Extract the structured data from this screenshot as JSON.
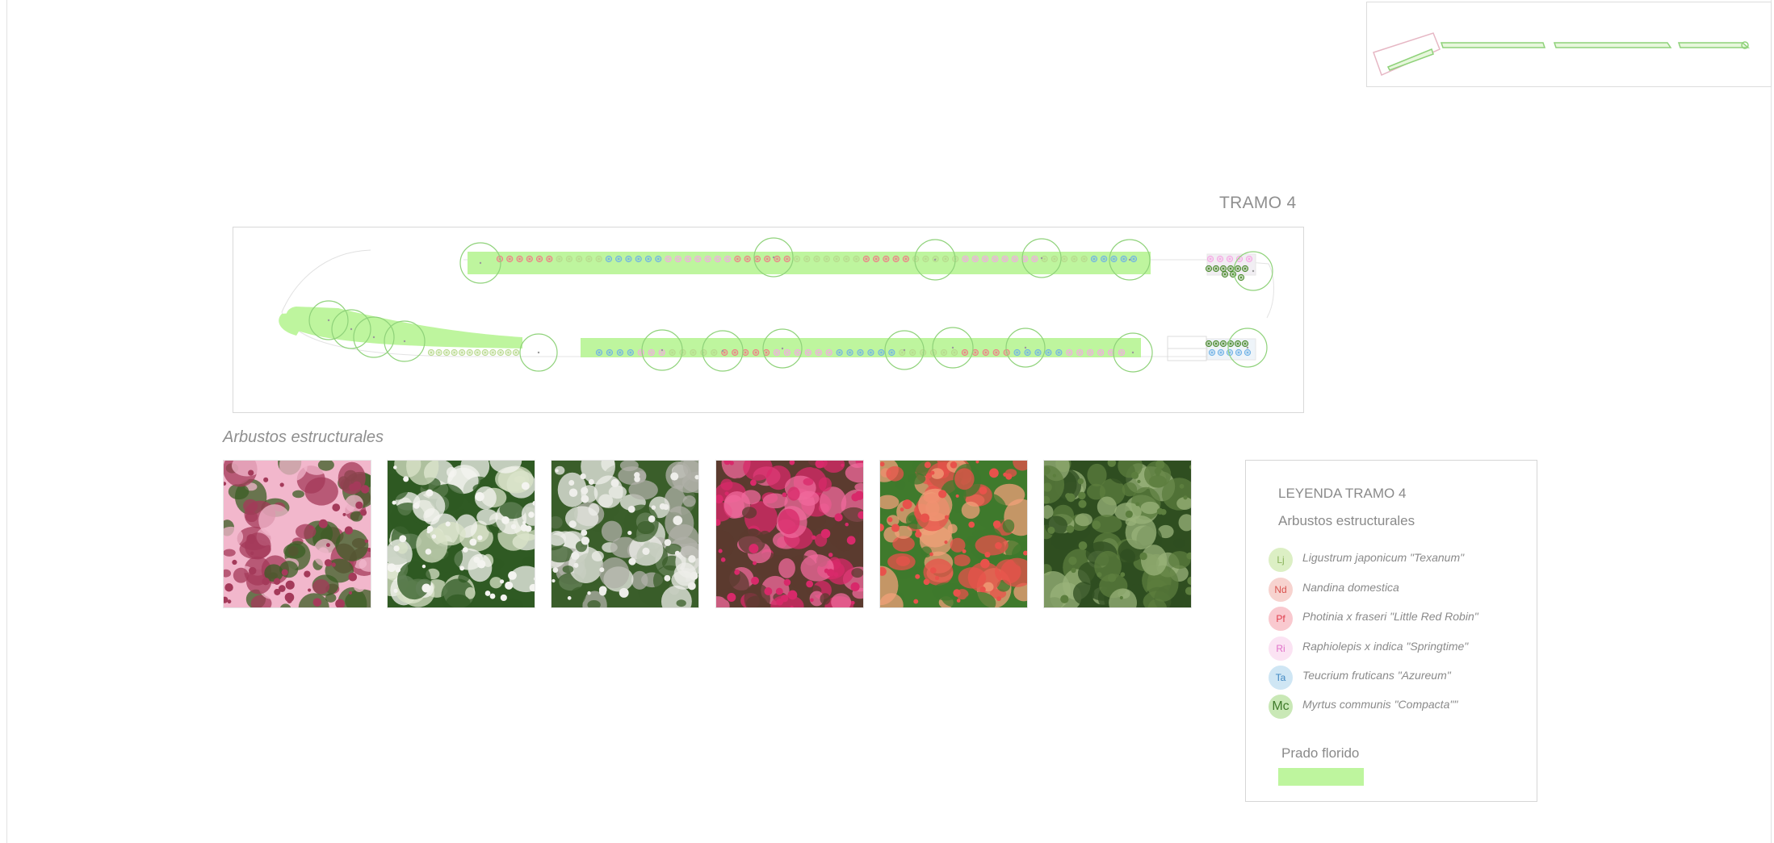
{
  "section": {
    "title": "TRAMO 4"
  },
  "gallery": {
    "title": "Arbustos estructurales",
    "photos": [
      {
        "name": "abelia-photo",
        "colors": [
          "#a43a5a",
          "#f2b7cc",
          "#3b5e24"
        ]
      },
      {
        "name": "white-flowers-photo",
        "colors": [
          "#f4f4f0",
          "#2f5a23",
          "#d9e3c8"
        ]
      },
      {
        "name": "white-flowers-2-photo",
        "colors": [
          "#eeeeea",
          "#3a5e2a",
          "#b0b0a8"
        ]
      },
      {
        "name": "loropetalum-photo",
        "colors": [
          "#d8296a",
          "#5b3b2f",
          "#f06a9c"
        ]
      },
      {
        "name": "photinia-photo",
        "colors": [
          "#e8524b",
          "#3f7a2c",
          "#f2a07a"
        ]
      },
      {
        "name": "myrtus-photo",
        "colors": [
          "#5c7e3e",
          "#2f4e20",
          "#9ab37a"
        ]
      }
    ]
  },
  "legend": {
    "title": "LEYENDA TRAMO 4",
    "subtitle": "Arbustos estructurales",
    "items": [
      {
        "code": "Lj",
        "label": "Ligustrum japonicum \"Texanum\"",
        "bg": "#dcefc4",
        "fg": "#8ab35a"
      },
      {
        "code": "Nd",
        "label": "Nandina domestica",
        "bg": "#f7d3cf",
        "fg": "#d9534f"
      },
      {
        "code": "Pf",
        "label": "Photinia x fraseri \"Little Red Robin\"",
        "bg": "#f9c9cf",
        "fg": "#e03c4c"
      },
      {
        "code": "Ri",
        "label": "Raphiolepis x indica \"Springtime\"",
        "bg": "#fbe3f3",
        "fg": "#e070c8"
      },
      {
        "code": "Ta",
        "label": "Teucrium fruticans \"Azureum\"",
        "bg": "#cfe6f4",
        "fg": "#3f87c2"
      },
      {
        "code": "Mc",
        "label": "Myrtus communis \"Compacta\"\"",
        "bg": "#c9e8b6",
        "fg": "#3f7a2a"
      }
    ],
    "prado_label": "Prado florido",
    "prado_color": "#bef59e"
  },
  "colors": {
    "meadow": "#bef59e",
    "tree_stroke": "#8fd27a",
    "outline": "#c8c8c8",
    "Lj": "#b8d98d",
    "Nd": "#f0a49e",
    "Pf": "#f07c86",
    "Ri": "#f5a8e4",
    "Ta": "#6fb2e6",
    "Mc": "#4b8a2e"
  },
  "plan": {
    "rows": [
      {
        "name": "upper-row",
        "sequence": [
          "Pf",
          "Pf",
          "Pf",
          "Pf",
          "Pf",
          "Pf",
          "Lj",
          "Lj",
          "Lj",
          "Lj",
          "Lj",
          "Ta",
          "Ta",
          "Ta",
          "Ta",
          "Ta",
          "Ta",
          "Ri",
          "Ri",
          "Ri",
          "Ri",
          "Ri",
          "Ri",
          "Ri",
          "Pf",
          "Pf",
          "Pf",
          "Pf",
          "Pf",
          "Pf",
          "Lj",
          "Lj",
          "Lj",
          "Lj",
          "Lj",
          "Lj",
          "Lj",
          "Pf",
          "Pf",
          "Pf",
          "Pf",
          "Pf",
          "Lj",
          "Lj",
          "Lj",
          "Lj",
          "Lj",
          "Ri",
          "Ri",
          "Ri",
          "Ri",
          "Ri",
          "Ri",
          "Ri",
          "Ri",
          "Lj",
          "Lj",
          "Lj",
          "Lj",
          "Lj",
          "Ta",
          "Ta",
          "Ta",
          "Ta",
          "Ta"
        ]
      },
      {
        "name": "lower-row",
        "sequence": [
          "Ta",
          "Ta",
          "Ta",
          "Ta",
          "Ri",
          "Ri",
          "Ri",
          "Lj",
          "Lj",
          "Lj",
          "Lj",
          "Lj",
          "Pf",
          "Pf",
          "Pf",
          "Pf",
          "Pf",
          "Ri",
          "Ri",
          "Ri",
          "Ri",
          "Ri",
          "Ri",
          "Ta",
          "Ta",
          "Ta",
          "Ta",
          "Ta",
          "Ta",
          "Lj",
          "Lj",
          "Lj",
          "Lj",
          "Lj",
          "Lj",
          "Pf",
          "Pf",
          "Pf",
          "Pf",
          "Pf",
          "Ta",
          "Ta",
          "Ta",
          "Ta",
          "Ta",
          "Ri",
          "Ri",
          "Ri",
          "Ri",
          "Ri",
          "Ri"
        ]
      },
      {
        "name": "lower-left-row",
        "sequence": [
          "Lj",
          "Lj",
          "Lj",
          "Lj",
          "Lj",
          "Lj",
          "Lj",
          "Lj",
          "Lj",
          "Lj",
          "Lj",
          "Lj"
        ]
      }
    ]
  }
}
